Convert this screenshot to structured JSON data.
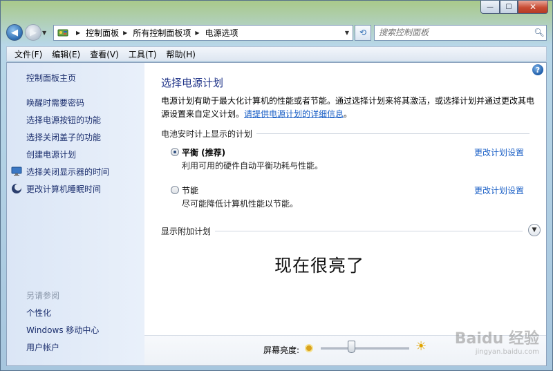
{
  "window": {
    "caption_buttons": {
      "minimize": "—",
      "maximize": "☐",
      "close": "✕"
    }
  },
  "address_bar": {
    "crumbs": [
      "控制面板",
      "所有控制面板项",
      "电源选项"
    ],
    "search_placeholder": "搜索控制面板"
  },
  "menu": [
    "文件(F)",
    "编辑(E)",
    "查看(V)",
    "工具(T)",
    "帮助(H)"
  ],
  "sidebar": {
    "home": "控制面板主页",
    "links": [
      "唤醒时需要密码",
      "选择电源按钮的功能",
      "选择关闭盖子的功能",
      "创建电源计划",
      "选择关闭显示器的时间",
      "更改计算机睡眠时间"
    ],
    "see_also_header": "另请参阅",
    "see_also": [
      "个性化",
      "Windows 移动中心",
      "用户帐户"
    ]
  },
  "main": {
    "title": "选择电源计划",
    "desc_line1": "电源计划有助于最大化计算机的性能或者节能。通过选择计划来将其激活，或选择计划并通过更改其电",
    "desc_line2": "源设置来自定义计划。",
    "desc_link": "请提供电源计划的详细信息",
    "desc_end": "。",
    "section_plans": "电池安时计上显示的计划",
    "plans": [
      {
        "name": "平衡 (推荐)",
        "desc": "利用可用的硬件自动平衡功耗与性能。",
        "change": "更改计划设置",
        "selected": true
      },
      {
        "name": "节能",
        "desc": "尽可能降低计算机性能以节能。",
        "change": "更改计划设置",
        "selected": false
      }
    ],
    "section_extra": "显示附加计划",
    "overlay_text": "现在很亮了"
  },
  "brightness": {
    "label": "屏幕亮度:",
    "level": 0.35
  },
  "watermark": {
    "line1": "Baidu 经验",
    "line2": "jingyan.baidu.com"
  },
  "colors": {
    "link": "#1a5fc6",
    "title": "#1e3287",
    "sidebar_link": "#1c2f6e"
  }
}
